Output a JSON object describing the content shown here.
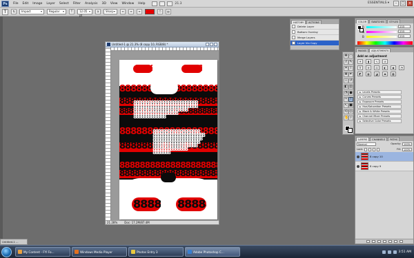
{
  "menubar": {
    "logo": "Ps",
    "items": [
      "File",
      "Edit",
      "Image",
      "Layer",
      "Select",
      "Filter",
      "Analysis",
      "3D",
      "View",
      "Window",
      "Help"
    ],
    "zoom": "21.3",
    "workspace": "ESSENTIALS ▾"
  },
  "options": {
    "tool_glyph": "T",
    "font_family": "Impact",
    "font_style": "Regular",
    "font_size": "12.05 pt",
    "antialias": "Sharp",
    "text_color": "#e60000"
  },
  "document": {
    "title": "Untitled-1 @ 21.3% (8 copy 10, RGB/8) *",
    "zoom_status": "21.28%",
    "doc_size": "Doc: 17.2M/87.4M",
    "canvas_colors": {
      "red": "#e10000",
      "black": "#0b0b0b",
      "white": "#ffffff"
    },
    "pattern_glyph": "8888888888888888888888888888"
  },
  "history": {
    "tabs": [
      "HISTORY",
      "ACTIONS"
    ],
    "rows": [
      "Delete Layer",
      "Bottom Overlay",
      "Merge Layers",
      "Layer Via Copy"
    ],
    "active_index": 3
  },
  "color_panel": {
    "tabs": [
      "COLOR",
      "SWATCHES",
      "STYLES"
    ],
    "channels": [
      {
        "label": "R",
        "value": "255"
      },
      {
        "label": "G",
        "value": "255"
      },
      {
        "label": "B",
        "value": "255"
      }
    ]
  },
  "adjustments": {
    "tabs": [
      "MASKS",
      "ADJUSTMENTS"
    ],
    "title": "Add an adjustment",
    "presets": [
      "Levels Presets",
      "Curves Presets",
      "Exposure Presets",
      "Hue/Saturation Presets",
      "Black & White Presets",
      "Channel Mixer Presets",
      "Selective Color Presets"
    ]
  },
  "layers": {
    "tabs": [
      "LAYERS",
      "CHANNELS",
      "PATHS"
    ],
    "blend_mode": "Normal",
    "opacity_label": "Opacity:",
    "opacity": "100%",
    "lock_label": "Lock:",
    "fill_label": "Fill:",
    "fill": "100%",
    "items": [
      {
        "name": "8 copy 10",
        "active": true
      },
      {
        "name": "8 copy 9",
        "active": false
      }
    ]
  },
  "minimized_doc": "Untitled-1 ...",
  "taskbar": {
    "buttons": [
      {
        "label": "My Content - FYI Fo...",
        "color": "#e8a040"
      },
      {
        "label": "Windows Media Player",
        "color": "#e07020"
      },
      {
        "label": "Photos Entry 3",
        "color": "#e8c840"
      },
      {
        "label": "Adobe Photoshop C...",
        "color": "#3a7fd0",
        "active": true
      }
    ],
    "clock": "3:51 AM"
  }
}
